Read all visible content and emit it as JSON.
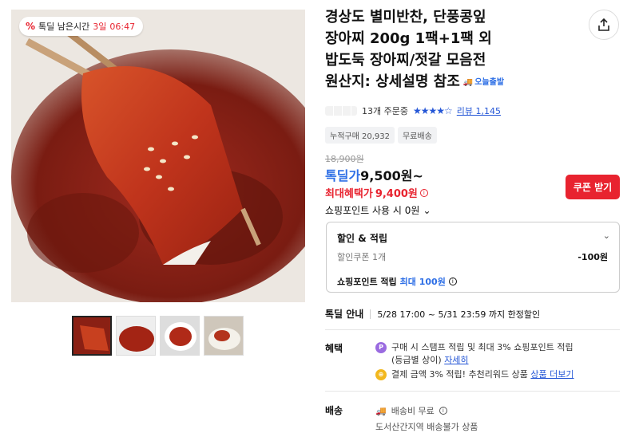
{
  "timer": {
    "label": "톡딜 남은시간",
    "days": "3일",
    "time": "06:47"
  },
  "product": {
    "title_lines": [
      "경상도 별미반찬, 단풍콩잎",
      "장아찌 200g 1팩+1팩 외",
      "밥도둑 장아찌/젓갈 모음전",
      "원산지: 상세설명 참조"
    ],
    "badge_today": "오늘출발",
    "order_count": "13개 주문중",
    "review_label": "리뷰 1,145",
    "rating_stars": 4.5,
    "tags": [
      "누적구매 20,932",
      "무료배송"
    ],
    "original_price": "18,900원",
    "sale_label": "톡딜가",
    "sale_price": "9,500원~",
    "max_benefit_label": "최대혜택가",
    "max_benefit_price": "9,400원",
    "coupon_button": "쿠폰 받기",
    "points_use": "쇼핑포인트 사용 시 0원"
  },
  "discount_box": {
    "title": "할인 & 적립",
    "coupon_label": "할인쿠폰 1개",
    "coupon_value": "-100원",
    "points_prefix": "쇼핑포인트 적립",
    "points_max": "최대 100원"
  },
  "deal": {
    "label": "톡딜 안내",
    "period": "5/28 17:00 ~ 5/31 23:59 까지 한정할인"
  },
  "benefit": {
    "label": "혜택",
    "line1": "구매 시 스탬프 적립 및 최대 3% 쇼핑포인트 적립",
    "line1b": "(등급별 상이)",
    "line1_link": "자세히",
    "line2": "결제 금액 3% 적립! 추천리워드 상품",
    "line2_link": "상품 더보기"
  },
  "shipping": {
    "label": "배송",
    "fee": "배송비 무료",
    "note": "도서산간지역 배송불가 상품"
  },
  "colors": {
    "accent_red": "#e8232f",
    "accent_blue": "#2e6fe6"
  },
  "icons": [
    "share-icon",
    "info-icon",
    "chevron-down-icon",
    "truck-icon",
    "stamp-icon",
    "coin-icon"
  ]
}
